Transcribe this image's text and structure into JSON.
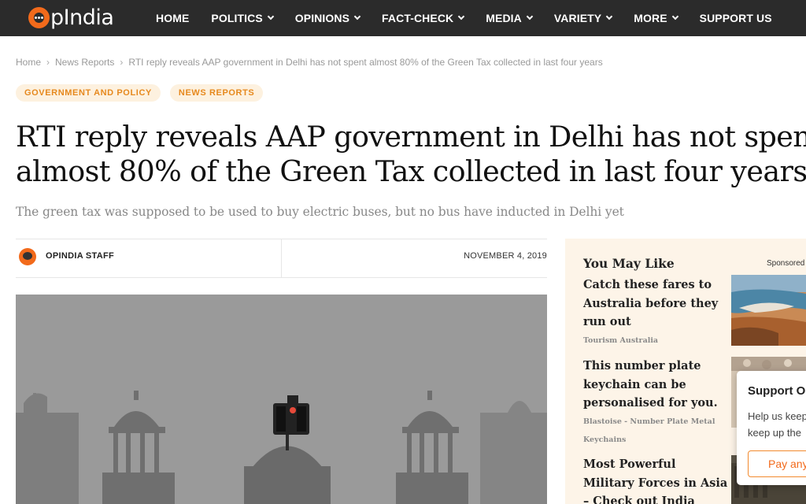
{
  "nav": {
    "logo_text": "pIndia",
    "items": [
      {
        "label": "HOME",
        "dropdown": false
      },
      {
        "label": "POLITICS",
        "dropdown": true
      },
      {
        "label": "OPINIONS",
        "dropdown": true
      },
      {
        "label": "FACT-CHECK",
        "dropdown": true
      },
      {
        "label": "MEDIA",
        "dropdown": true
      },
      {
        "label": "VARIETY",
        "dropdown": true
      },
      {
        "label": "MORE",
        "dropdown": true
      },
      {
        "label": "SUPPORT US",
        "dropdown": false
      }
    ]
  },
  "breadcrumb": {
    "home": "Home",
    "section": "News Reports",
    "current": "RTI reply reveals AAP government in Delhi has not spent almost 80% of the Green Tax collected in last four years",
    "separator": "›"
  },
  "tags": [
    "GOVERNMENT AND POLICY",
    "NEWS REPORTS"
  ],
  "article": {
    "title_line1": "RTI reply reveals AAP government in Delhi has not spent",
    "title_line2": "almost 80% of the Green Tax collected in last four years",
    "subtitle": "The green tax was supposed to be used to buy electric buses, but no bus have inducted in Delhi yet",
    "author": "OPINDIA STAFF",
    "date": "NOVEMBER 4, 2019"
  },
  "sidebar": {
    "title": "You May Like",
    "sponsored": "Sponsored",
    "items": [
      {
        "title": "Catch these fares to Australia before they run out",
        "source": "Tourism Australia"
      },
      {
        "title": "This number plate keychain can be personalised for you.",
        "source": "Blastoise - Number Plate Metal Keychains"
      },
      {
        "title": "Most Powerful Military Forces in Asia – Check out India Rank",
        "source": ""
      }
    ]
  },
  "support_popup": {
    "title": "Support O",
    "line1": "Help us keep",
    "line2": "keep up the",
    "button": "Pay any"
  },
  "colors": {
    "brand_orange": "#f26a1b",
    "nav_bg": "#2b2b2b",
    "tag_bg": "#fdf1df",
    "tag_text": "#e6891e",
    "sidebar_bg": "#fdf4e8"
  }
}
